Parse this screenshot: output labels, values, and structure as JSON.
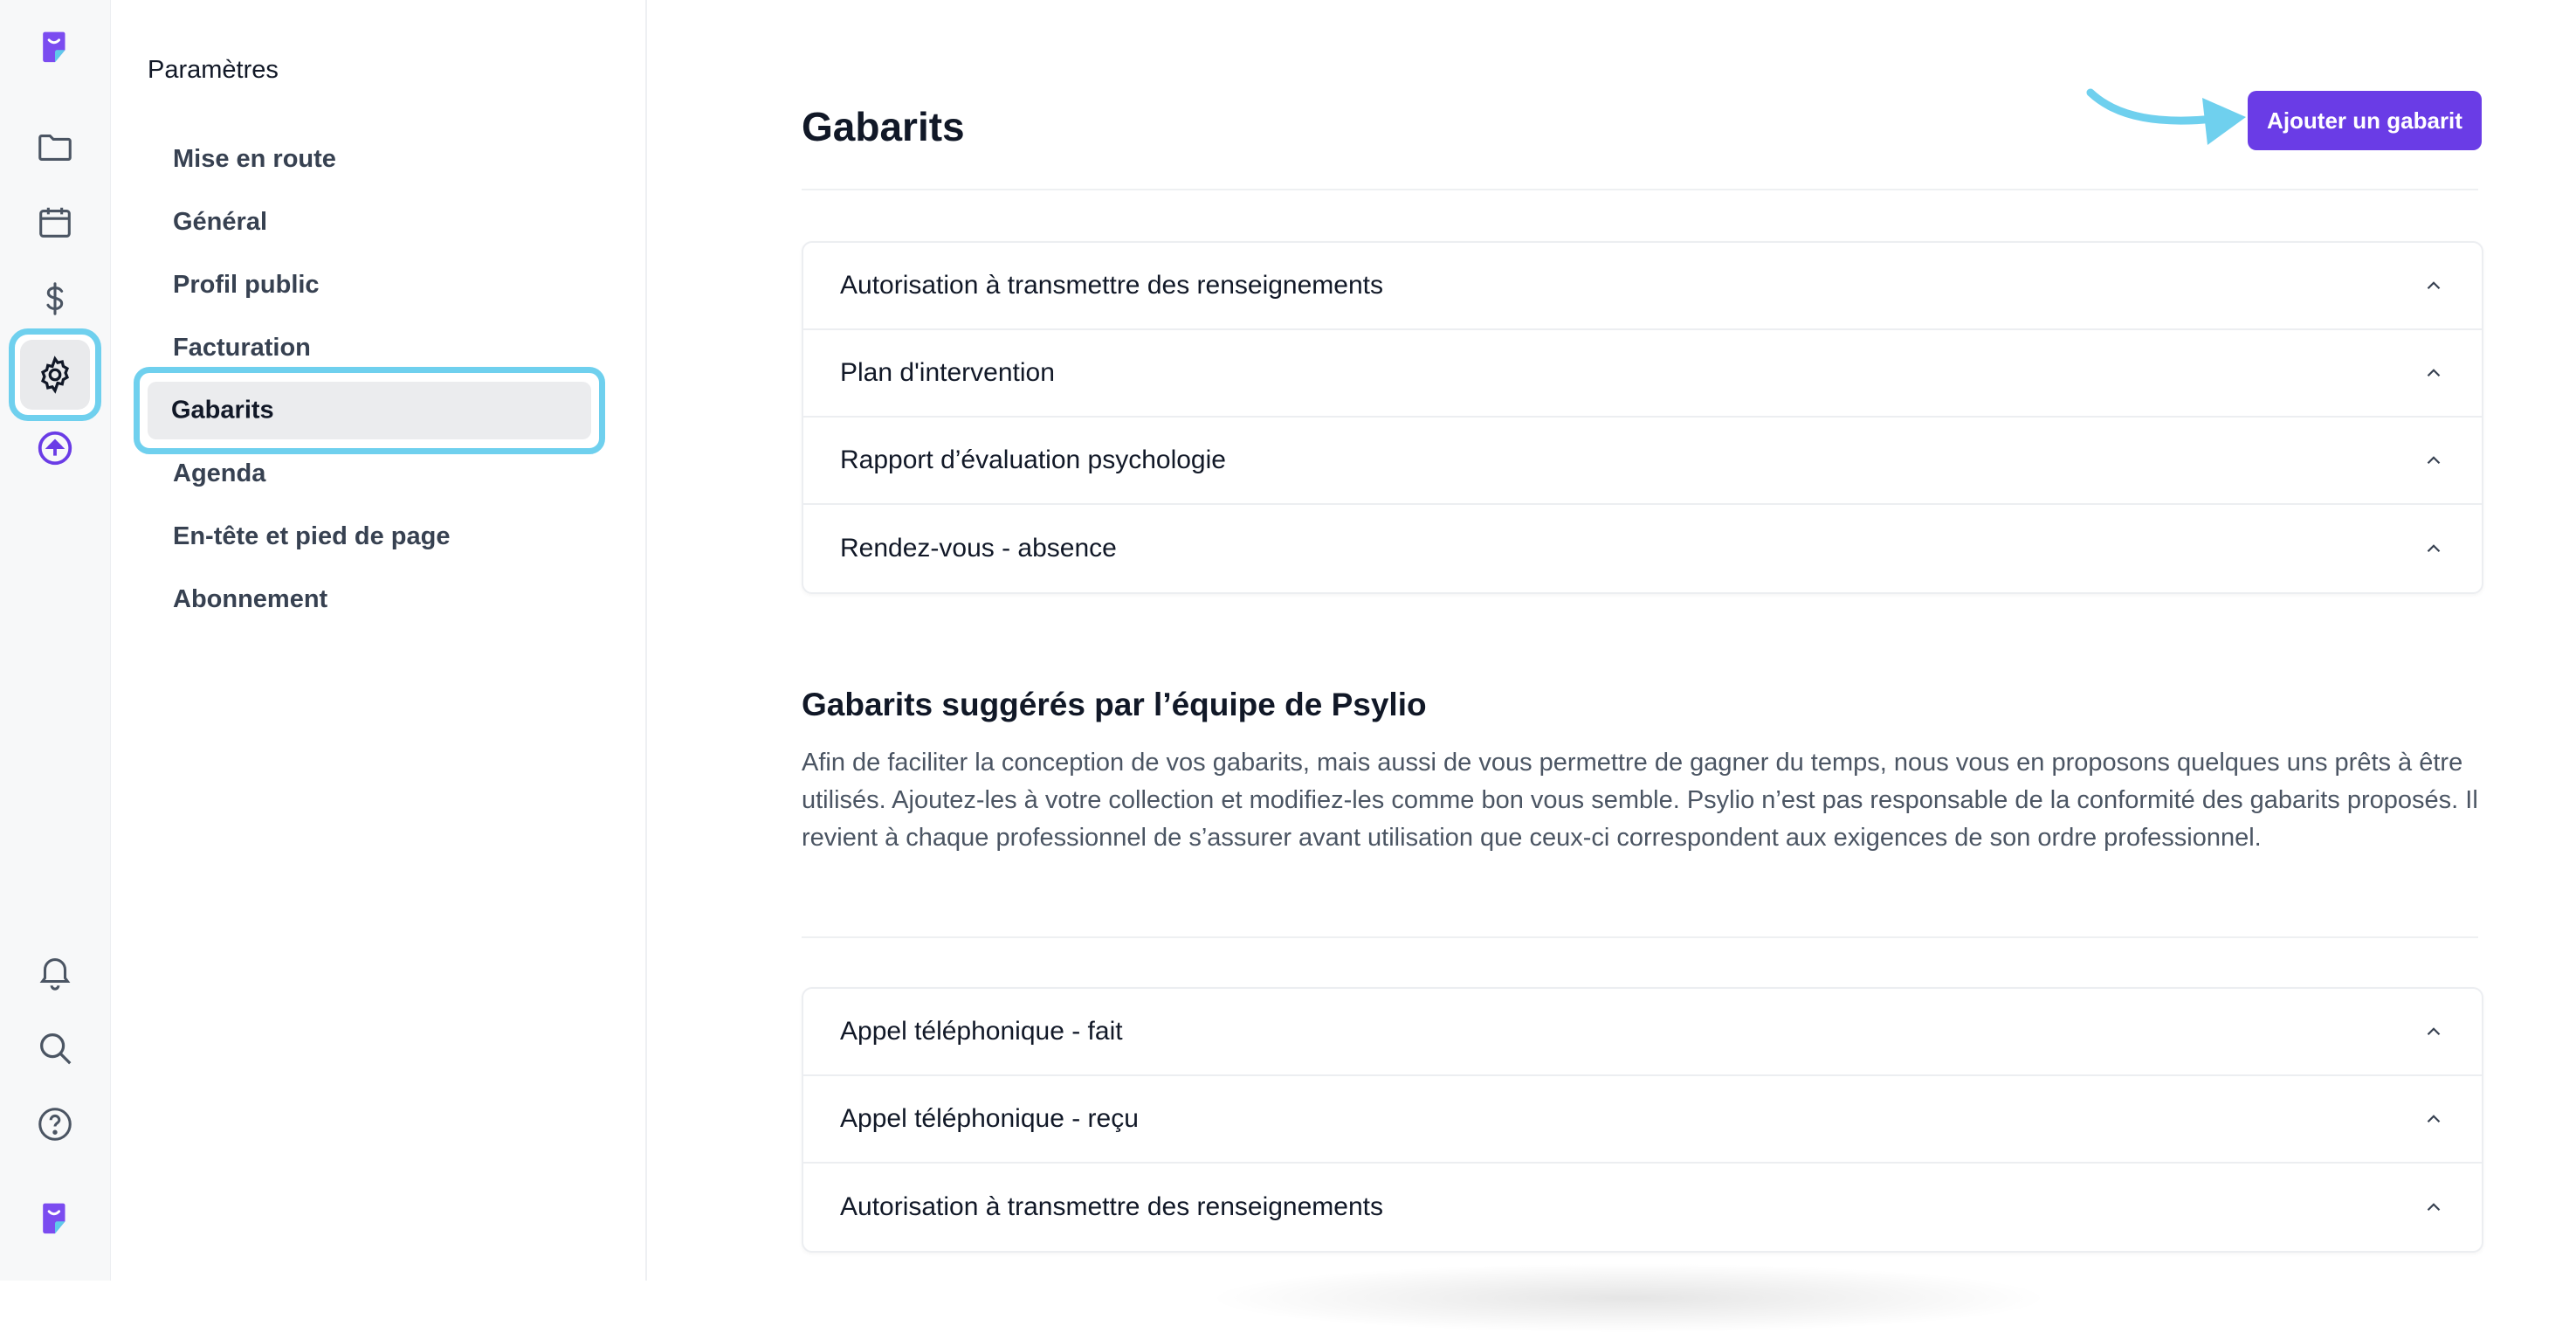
{
  "rail": {
    "icons": [
      "logo-icon",
      "folder-icon",
      "calendar-icon",
      "dollar-icon",
      "gear-icon",
      "upload-circle-icon",
      "bell-icon",
      "search-icon",
      "help-icon",
      "logo-icon"
    ],
    "accent": "#6fd0ee",
    "brand": "#6a3ce6"
  },
  "sidebar": {
    "title": "Paramètres",
    "items": [
      {
        "label": "Mise en route"
      },
      {
        "label": "Général"
      },
      {
        "label": "Profil public"
      },
      {
        "label": "Facturation"
      },
      {
        "label": "Gabarits",
        "active": true
      },
      {
        "label": "Agenda"
      },
      {
        "label": "En-tête et pied de page"
      },
      {
        "label": "Abonnement"
      }
    ]
  },
  "main": {
    "title": "Gabarits",
    "add_button": "Ajouter un gabarit",
    "templates": [
      "Autorisation à transmettre des renseignements",
      "Plan d'intervention",
      "Rapport d’évaluation psychologie",
      "Rendez-vous - absence"
    ],
    "suggested": {
      "title": "Gabarits suggérés par l’équipe de Psylio",
      "description": "Afin de faciliter la conception de vos gabarits, mais aussi de vous permettre de gagner du temps, nous vous en proposons quelques uns prêts à être utilisés. Ajoutez-les à votre collection et modifiez-les comme bon vous semble. Psylio n’est pas responsable de la conformité des gabarits proposés. Il revient à chaque professionnel de s’assurer avant utilisation que ceux-ci correspondent aux exigences de son ordre professionnel.",
      "templates": [
        "Appel téléphonique - fait",
        "Appel téléphonique - reçu",
        "Autorisation à transmettre des renseignements"
      ]
    }
  }
}
